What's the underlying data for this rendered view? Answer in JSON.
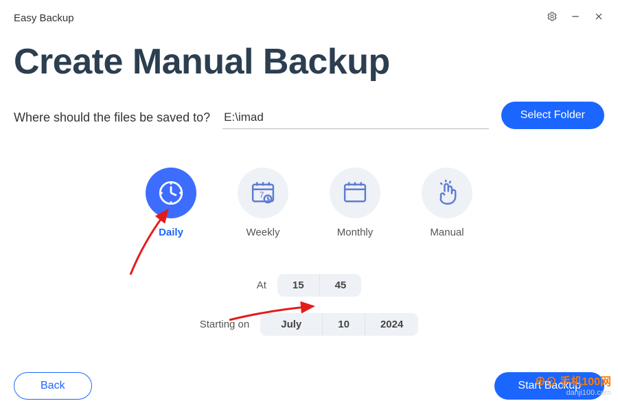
{
  "app": {
    "title": "Easy Backup"
  },
  "header": {
    "title": "Create Manual Backup"
  },
  "destination": {
    "label": "Where should the files be saved to?",
    "value": "E:\\imad",
    "select_button": "Select Folder"
  },
  "schedule": {
    "options": [
      {
        "key": "daily",
        "label": "Daily",
        "selected": true
      },
      {
        "key": "weekly",
        "label": "Weekly",
        "selected": false
      },
      {
        "key": "monthly",
        "label": "Monthly",
        "selected": false
      },
      {
        "key": "manual",
        "label": "Manual",
        "selected": false
      }
    ],
    "at_label": "At",
    "time": {
      "hour": "15",
      "minute": "45"
    },
    "starting_label": "Starting on",
    "start_date": {
      "month": "July",
      "day": "10",
      "year": "2024"
    }
  },
  "footer": {
    "back": "Back",
    "start": "Start Backup"
  },
  "watermark": {
    "line1": "手机100网",
    "line2": "danji100.com"
  },
  "colors": {
    "primary": "#1b66ff",
    "accent_bg": "#eef1f5"
  }
}
